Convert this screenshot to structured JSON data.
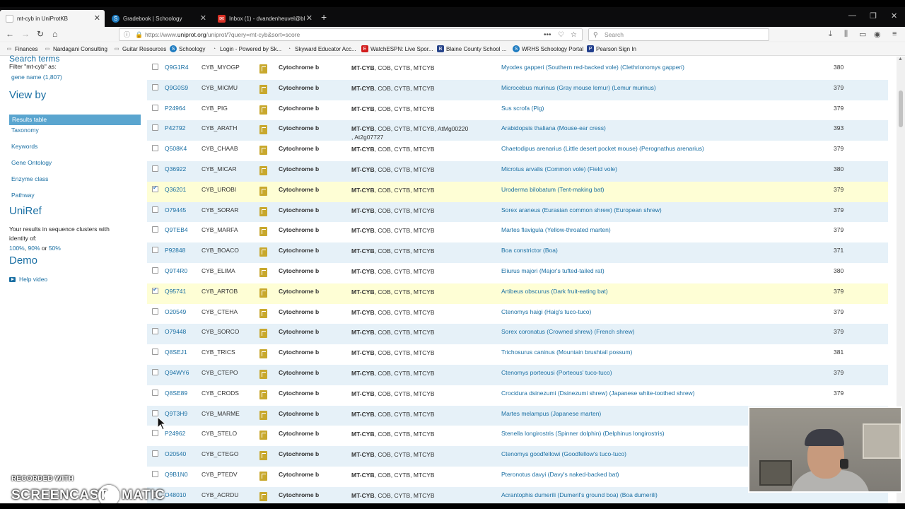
{
  "browser": {
    "tabs": [
      {
        "label": "mt-cyb in UniProtKB",
        "active": true
      },
      {
        "label": "Gradebook | Schoology",
        "active": false
      },
      {
        "label": "Inbox (1) - dvandenheuvel@bl",
        "active": false
      }
    ],
    "url_prefix": "https://www.",
    "url_host": "uniprot.org",
    "url_path": "/uniprot/?query=mt-cyb&sort=score",
    "search_placeholder": "Search",
    "bookmarks": [
      {
        "label": "Finances",
        "icon": "folder-icon"
      },
      {
        "label": "Nardagani Consulting",
        "icon": "folder-icon"
      },
      {
        "label": "Guitar Resources",
        "icon": "folder-icon"
      },
      {
        "label": "Schoology",
        "icon": "schoology-icon"
      },
      {
        "label": "Login - Powered by Sk...",
        "icon": "login-icon"
      },
      {
        "label": "Skyward Educator Acc...",
        "icon": "skyward-icon"
      },
      {
        "label": "WatchESPN: Live Spor...",
        "icon": "espn-icon"
      },
      {
        "label": "Blaine County School ...",
        "icon": "school-icon"
      },
      {
        "label": "WRHS Schoology Portal",
        "icon": "schoology-icon"
      },
      {
        "label": "Pearson Sign In",
        "icon": "pearson-icon"
      }
    ]
  },
  "sidebar": {
    "cut_heading": "Search terms",
    "filter_label": "Filter \"mt-cyb\" as:",
    "filter_link": "gene name (1,807)",
    "view_by_heading": "View by",
    "view_items": [
      "Results table",
      "Taxonomy",
      "Keywords",
      "Gene Ontology",
      "Enzyme class",
      "Pathway"
    ],
    "uniref_heading": "UniRef",
    "uniref_text_1": "Your results in sequence clusters with",
    "uniref_text_2": "identity of:",
    "uniref_link_100": "100%",
    "uniref_link_90": "90%",
    "uniref_or": "or",
    "uniref_link_50": "50%",
    "uniref_comma": ",",
    "demo_heading": "Demo",
    "help_video": "Help video"
  },
  "table": {
    "rows": [
      {
        "acc": "Q9G1R4",
        "entry": "CYB_MYOGP",
        "protein": "Cytochrome b",
        "gene_main": "MT-CYB",
        "gene_rest": ", COB, CYTB, MTCYB",
        "organism": "Myodes gapperi (Southern red-backed vole) (Clethrionomys gapperi)",
        "length": "380",
        "checked": false
      },
      {
        "acc": "Q9G0S9",
        "entry": "CYB_MICMU",
        "protein": "Cytochrome b",
        "gene_main": "MT-CYB",
        "gene_rest": ", COB, CYTB, MTCYB",
        "organism": "Microcebus murinus (Gray mouse lemur) (Lemur murinus)",
        "length": "379",
        "checked": false
      },
      {
        "acc": "P24964",
        "entry": "CYB_PIG",
        "protein": "Cytochrome b",
        "gene_main": "MT-CYB",
        "gene_rest": ", COB, CYTB, MTCYB",
        "organism": "Sus scrofa (Pig)",
        "length": "379",
        "checked": false
      },
      {
        "acc": "P42792",
        "entry": "CYB_ARATH",
        "protein": "Cytochrome b",
        "gene_main": "MT-CYB",
        "gene_rest": ", COB, CYTB, MTCYB, AtMg00220",
        "gene_line2": ", At2g07727",
        "organism": "Arabidopsis thaliana (Mouse-ear cress)",
        "length": "393",
        "checked": false
      },
      {
        "acc": "Q508K4",
        "entry": "CYB_CHAAB",
        "protein": "Cytochrome b",
        "gene_main": "MT-CYB",
        "gene_rest": ", COB, CYTB, MTCYB",
        "organism": "Chaetodipus arenarius (Little desert pocket mouse) (Perognathus arenarius)",
        "length": "379",
        "checked": false
      },
      {
        "acc": "Q36922",
        "entry": "CYB_MICAR",
        "protein": "Cytochrome b",
        "gene_main": "MT-CYB",
        "gene_rest": ", COB, CYTB, MTCYB",
        "organism": "Microtus arvalis (Common vole) (Field vole)",
        "length": "380",
        "checked": false
      },
      {
        "acc": "Q36201",
        "entry": "CYB_UROBI",
        "protein": "Cytochrome b",
        "gene_main": "MT-CYB",
        "gene_rest": ", COB, CYTB, MTCYB",
        "organism": "Uroderma bilobatum (Tent-making bat)",
        "length": "379",
        "checked": true
      },
      {
        "acc": "O79445",
        "entry": "CYB_SORAR",
        "protein": "Cytochrome b",
        "gene_main": "MT-CYB",
        "gene_rest": ", COB, CYTB, MTCYB",
        "organism": "Sorex araneus (Eurasian common shrew) (European shrew)",
        "length": "379",
        "checked": false
      },
      {
        "acc": "Q9TEB4",
        "entry": "CYB_MARFA",
        "protein": "Cytochrome b",
        "gene_main": "MT-CYB",
        "gene_rest": ", COB, CYTB, MTCYB",
        "organism": "Martes flavigula (Yellow-throated marten)",
        "length": "379",
        "checked": false
      },
      {
        "acc": "P92848",
        "entry": "CYB_BOACO",
        "protein": "Cytochrome b",
        "gene_main": "MT-CYB",
        "gene_rest": ", COB, CYTB, MTCYB",
        "organism": "Boa constrictor (Boa)",
        "length": "371",
        "checked": false
      },
      {
        "acc": "Q9T4R0",
        "entry": "CYB_ELIMA",
        "protein": "Cytochrome b",
        "gene_main": "MT-CYB",
        "gene_rest": ", COB, CYTB, MTCYB",
        "organism": "Eliurus majori (Major's tufted-tailed rat)",
        "length": "380",
        "checked": false
      },
      {
        "acc": "Q95741",
        "entry": "CYB_ARTOB",
        "protein": "Cytochrome b",
        "gene_main": "MT-CYB",
        "gene_rest": ", COB, CYTB, MTCYB",
        "organism": "Artibeus obscurus (Dark fruit-eating bat)",
        "length": "379",
        "checked": true
      },
      {
        "acc": "O20549",
        "entry": "CYB_CTEHA",
        "protein": "Cytochrome b",
        "gene_main": "MT-CYB",
        "gene_rest": ", COB, CYTB, MTCYB",
        "organism": "Ctenomys haigi (Haig's tuco-tuco)",
        "length": "379",
        "checked": false
      },
      {
        "acc": "O79448",
        "entry": "CYB_SORCO",
        "protein": "Cytochrome b",
        "gene_main": "MT-CYB",
        "gene_rest": ", COB, CYTB, MTCYB",
        "organism": "Sorex coronatus (Crowned shrew) (French shrew)",
        "length": "379",
        "checked": false
      },
      {
        "acc": "Q8SEJ1",
        "entry": "CYB_TRICS",
        "protein": "Cytochrome b",
        "gene_main": "MT-CYB",
        "gene_rest": ", COB, CYTB, MTCYB",
        "organism": "Trichosurus caninus (Mountain brushtail possum)",
        "length": "381",
        "checked": false
      },
      {
        "acc": "Q94WY6",
        "entry": "CYB_CTEPO",
        "protein": "Cytochrome b",
        "gene_main": "MT-CYB",
        "gene_rest": ", COB, CYTB, MTCYB",
        "organism": "Ctenomys porteousi (Porteous' tuco-tuco)",
        "length": "379",
        "checked": false
      },
      {
        "acc": "Q8SE89",
        "entry": "CYB_CRODS",
        "protein": "Cytochrome b",
        "gene_main": "MT-CYB",
        "gene_rest": ", COB, CYTB, MTCYB",
        "organism": "Crocidura dsinezumi (Dsinezumi shrew) (Japanese white-toothed shrew)",
        "length": "379",
        "checked": false
      },
      {
        "acc": "Q9T3H9",
        "entry": "CYB_MARME",
        "protein": "Cytochrome b",
        "gene_main": "MT-CYB",
        "gene_rest": ", COB, CYTB, MTCYB",
        "organism": "Martes melampus (Japanese marten)",
        "length": "",
        "checked": false
      },
      {
        "acc": "P24962",
        "entry": "CYB_STELO",
        "protein": "Cytochrome b",
        "gene_main": "MT-CYB",
        "gene_rest": ", COB, CYTB, MTCYB",
        "organism": "Stenella longirostris (Spinner dolphin) (Delphinus longirostris)",
        "length": "",
        "checked": false
      },
      {
        "acc": "O20540",
        "entry": "CYB_CTEGO",
        "protein": "Cytochrome b",
        "gene_main": "MT-CYB",
        "gene_rest": ", COB, CYTB, MTCYB",
        "organism": "Ctenomys goodfellowi (Goodfellow's tuco-tuco)",
        "length": "",
        "checked": false
      },
      {
        "acc": "Q9B1N0",
        "entry": "CYB_PTEDV",
        "protein": "Cytochrome b",
        "gene_main": "MT-CYB",
        "gene_rest": ", COB, CYTB, MTCYB",
        "organism": "Pteronotus davyi (Davy's naked-backed bat)",
        "length": "",
        "checked": false
      },
      {
        "acc": "O48010",
        "entry": "CYB_ACRDU",
        "protein": "Cytochrome b",
        "gene_main": "MT-CYB",
        "gene_rest": ", COB, CYTB, MTCYB",
        "organism": "Acrantophis dumerili (Dumeril's ground boa) (Boa dumerili)",
        "length": "",
        "checked": false
      }
    ]
  },
  "watermark": {
    "line1": "RECORDED WITH",
    "line2a": "SCREENCAST",
    "line2b": "MATIC"
  },
  "colors": {
    "link": "#1a6fa3",
    "row_alt": "#e6f1f8",
    "row_selected": "#fefed5",
    "active_nav": "#5aa5cf",
    "reviewed_icon": "#c8a82d"
  }
}
